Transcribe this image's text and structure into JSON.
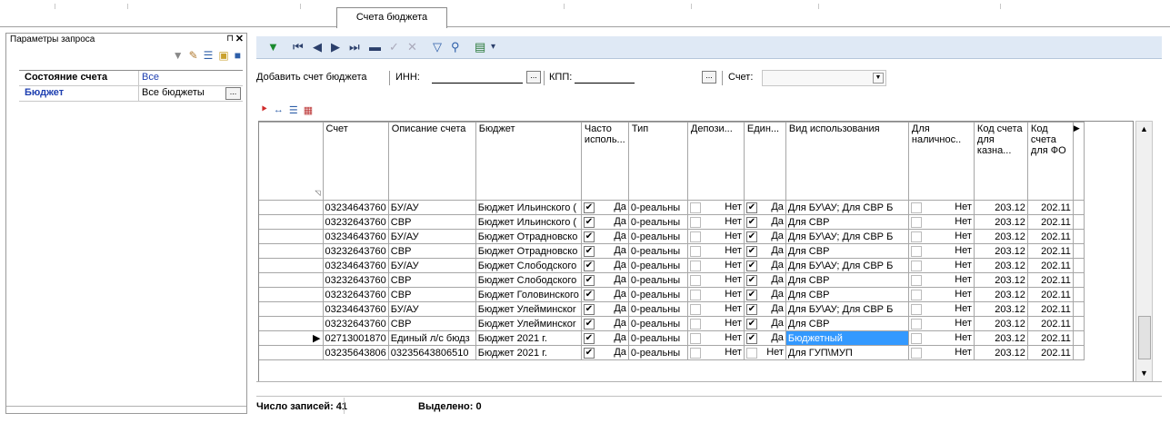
{
  "tab": {
    "label": "Счета бюджета"
  },
  "left_panel": {
    "title": "Параметры запроса",
    "rows": [
      {
        "key": "Состояние счета",
        "value": "Все"
      },
      {
        "key": "Бюджет",
        "value": "Все бюджеты"
      }
    ]
  },
  "toolbar": {
    "icons": [
      "funnel-green-icon",
      "first-record-icon",
      "prev-record-icon",
      "next-record-icon",
      "last-record-icon",
      "delete-icon",
      "confirm-icon",
      "cancel-icon",
      "filter-icon",
      "find-icon",
      "export-icon",
      "dropdown-arrow-icon"
    ]
  },
  "add_row": {
    "add_label": "Добавить счет бюджета",
    "inn_label": "ИНН:",
    "kpp_label": "КПП:",
    "account_label": "Счет:",
    "ellipsis": "..."
  },
  "grid": {
    "columns": [
      "Счет",
      "Описание счета",
      "Бюджет",
      "Часто исполь...",
      "Тип",
      "Депози...",
      "Един...",
      "Вид использования",
      "Для наличнос..",
      "Код счета для казна...",
      "Код счета для ФО"
    ],
    "rows": [
      {
        "acct": "03234643760",
        "desc": "БУ/АУ",
        "budget": "Бюджет Ильинского (",
        "often": "Да",
        "type": "0-реальны",
        "depo": "Нет",
        "uni": "Да",
        "vid": "Для БУ\\АУ; Для СВР Б",
        "cash": "Нет",
        "kod1": "203.12",
        "kod2": "202.11"
      },
      {
        "acct": "03232643760",
        "desc": "СВР",
        "budget": "Бюджет Ильинского (",
        "often": "Да",
        "type": "0-реальны",
        "depo": "Нет",
        "uni": "Да",
        "vid": "Для СВР",
        "cash": "Нет",
        "kod1": "203.12",
        "kod2": "202.11"
      },
      {
        "acct": "03234643760",
        "desc": "БУ/АУ",
        "budget": "Бюджет Отрадновско",
        "often": "Да",
        "type": "0-реальны",
        "depo": "Нет",
        "uni": "Да",
        "vid": "Для БУ\\АУ; Для СВР Б",
        "cash": "Нет",
        "kod1": "203.12",
        "kod2": "202.11"
      },
      {
        "acct": "03232643760",
        "desc": "СВР",
        "budget": "Бюджет Отрадновско",
        "often": "Да",
        "type": "0-реальны",
        "depo": "Нет",
        "uni": "Да",
        "vid": "Для СВР",
        "cash": "Нет",
        "kod1": "203.12",
        "kod2": "202.11"
      },
      {
        "acct": "03234643760",
        "desc": "БУ/АУ",
        "budget": "Бюджет Слободского",
        "often": "Да",
        "type": "0-реальны",
        "depo": "Нет",
        "uni": "Да",
        "vid": "Для БУ\\АУ; Для СВР Б",
        "cash": "Нет",
        "kod1": "203.12",
        "kod2": "202.11"
      },
      {
        "acct": "03232643760",
        "desc": "СВР",
        "budget": "Бюджет Слободского",
        "often": "Да",
        "type": "0-реальны",
        "depo": "Нет",
        "uni": "Да",
        "vid": "Для СВР",
        "cash": "Нет",
        "kod1": "203.12",
        "kod2": "202.11"
      },
      {
        "acct": "03232643760",
        "desc": "СВР",
        "budget": "Бюджет Головинского",
        "often": "Да",
        "type": "0-реальны",
        "depo": "Нет",
        "uni": "Да",
        "vid": "Для СВР",
        "cash": "Нет",
        "kod1": "203.12",
        "kod2": "202.11"
      },
      {
        "acct": "03234643760",
        "desc": "БУ/АУ",
        "budget": "Бюджет Улейминскоr",
        "often": "Да",
        "type": "0-реальны",
        "depo": "Нет",
        "uni": "Да",
        "vid": "Для БУ\\АУ; Для СВР Б",
        "cash": "Нет",
        "kod1": "203.12",
        "kod2": "202.11"
      },
      {
        "acct": "03232643760",
        "desc": "СВР",
        "budget": "Бюджет Улейминскоr",
        "often": "Да",
        "type": "0-реальны",
        "depo": "Нет",
        "uni": "Да",
        "vid": "Для СВР",
        "cash": "Нет",
        "kod1": "203.12",
        "kod2": "202.11"
      },
      {
        "acct": "02713001870",
        "desc": "Единый л/с бюдз",
        "budget": "Бюджет 2021 г.",
        "often": "Да",
        "type": "0-реальны",
        "depo": "Нет",
        "uni": "Да",
        "vid": "Бюджетный",
        "cash": "Нет",
        "kod1": "203.12",
        "kod2": "202.11",
        "selected": true
      },
      {
        "acct": "03235643806",
        "desc": "03235643806510",
        "budget": "Бюджет 2021 г.",
        "often": "Да",
        "type": "0-реальны",
        "depo": "Нет",
        "uni": "Нет",
        "vid": "Для ГУП\\МУП",
        "cash": "Нет",
        "kod1": "203.12",
        "kod2": "202.11"
      }
    ]
  },
  "status": {
    "count_label": "Число записей:",
    "count": "41",
    "selected_label": "Выделено:",
    "selected": "0"
  }
}
